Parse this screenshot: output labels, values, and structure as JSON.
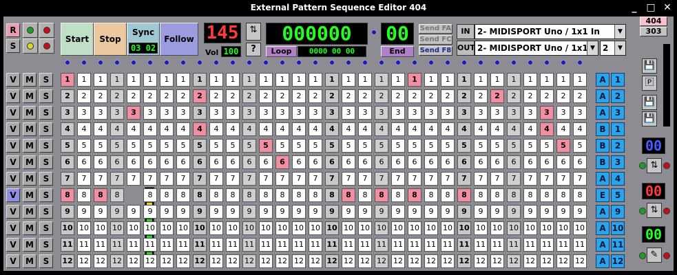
{
  "window": {
    "title": "External Pattern Sequence Editor 404",
    "min": "_",
    "max": "□",
    "close": "✕"
  },
  "left_controls": {
    "r_label": "R",
    "s_label": "S"
  },
  "transport": {
    "start": "Start",
    "stop": "Stop",
    "sync": "Sync",
    "follow": "Follow",
    "sync_value": "03 02",
    "tempo": "145",
    "vol_label": "Vol",
    "vol_value": "100",
    "help": "?",
    "position": "000000",
    "end_value": "00",
    "loop": "Loop",
    "loop_value": "0000 00 00",
    "end": "End"
  },
  "send": {
    "fa": "Send FA",
    "fc": "Send FC",
    "f8": "Send F8"
  },
  "midi": {
    "in_label": "IN",
    "out_label": "OUT",
    "in_device": "2- MIDISPORT Uno / 1x1 In",
    "out_device": "2- MIDISPORT Uno / 1x1 Out",
    "channel": "2"
  },
  "model": {
    "a": "404",
    "b": "303"
  },
  "side_displays": {
    "d1": "00",
    "d2": "00",
    "d3": "00"
  },
  "rows": [
    {
      "v": "V",
      "m": "M",
      "s": "S",
      "bank": "A",
      "num": "1"
    },
    {
      "v": "V",
      "m": "M",
      "s": "S",
      "bank": "A",
      "num": "2"
    },
    {
      "v": "V",
      "m": "M",
      "s": "S",
      "bank": "A",
      "num": "3"
    },
    {
      "v": "V",
      "m": "M",
      "s": "S",
      "bank": "B",
      "num": "1"
    },
    {
      "v": "V",
      "m": "M",
      "s": "S",
      "bank": "B",
      "num": "2"
    },
    {
      "v": "V",
      "m": "M",
      "s": "S",
      "bank": "B",
      "num": "3"
    },
    {
      "v": "V",
      "m": "M",
      "s": "S",
      "bank": "A",
      "num": "4"
    },
    {
      "v": "V",
      "m": "M",
      "s": "S",
      "bank": "E",
      "num": "5"
    },
    {
      "v": "V",
      "m": "M",
      "s": "S",
      "bank": "A",
      "num": "9"
    },
    {
      "v": "V",
      "m": "M",
      "s": "S",
      "bank": "A",
      "num": "10"
    },
    {
      "v": "V",
      "m": "M",
      "s": "S",
      "bank": "A",
      "num": "11"
    },
    {
      "v": "V",
      "m": "M",
      "s": "S",
      "bank": "A",
      "num": "12"
    }
  ],
  "grid": {
    "steps": 32,
    "hits": {
      "1": [
        1,
        22
      ],
      "2": [
        9,
        27
      ],
      "3": [
        5,
        30
      ],
      "4": [
        9,
        30
      ],
      "5": [
        13,
        31
      ],
      "6": [
        14,
        33
      ],
      "8": [
        1,
        3,
        5,
        18,
        20,
        22,
        25
      ],
      "12": []
    }
  },
  "colors": {
    "accent_pink": "#f48da0",
    "bank_blue": "#2aa4ea",
    "led_green": "#22ff22",
    "led_red": "#ff3b3b"
  }
}
